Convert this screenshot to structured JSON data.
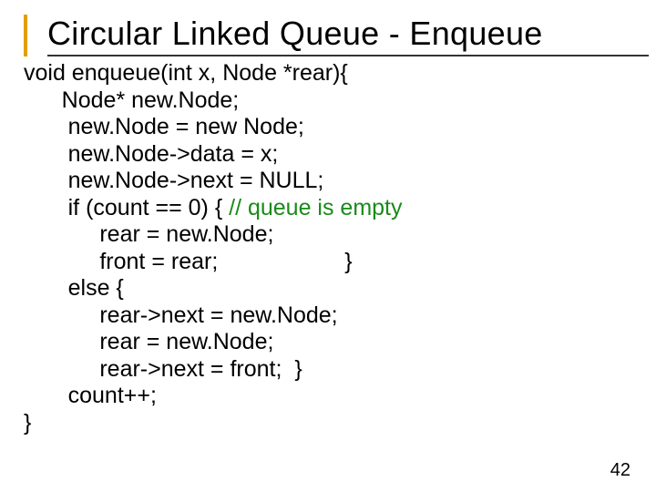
{
  "title": "Circular Linked Queue - Enqueue",
  "code": {
    "l1": "void enqueue(int x, Node *rear){",
    "l2": "      Node* new.Node;",
    "l3": "       new.Node = new Node;",
    "l4": "       new.Node->data = x;",
    "l5": "       new.Node->next = NULL;",
    "l6a": "       if (count == 0) { ",
    "l6b": "// queue is empty",
    "l7": "            rear = new.Node;",
    "l8a": "            front = rear;",
    "l8b": "                    }",
    "l9": "       else {",
    "l10": "            rear->next = new.Node;",
    "l11": "            rear = new.Node;",
    "l12": "            rear->next = front;  }",
    "l13": "       count++;",
    "l14": "}"
  },
  "pagenum": "42"
}
